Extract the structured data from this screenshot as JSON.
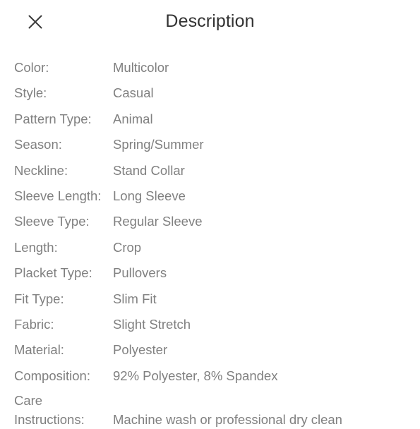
{
  "header": {
    "title": "Description",
    "close_icon": "close-icon"
  },
  "colors": {
    "background": "#ffffff",
    "title_text": "#333333",
    "body_text": "#808080",
    "icon": "#3c3c3c"
  },
  "attributes": [
    {
      "label": "Color:",
      "value": "Multicolor"
    },
    {
      "label": "Style:",
      "value": "Casual"
    },
    {
      "label": "Pattern Type:",
      "value": "Animal"
    },
    {
      "label": "Season:",
      "value": "Spring/Summer"
    },
    {
      "label": "Neckline:",
      "value": "Stand Collar"
    },
    {
      "label": "Sleeve Length:",
      "value": "Long Sleeve"
    },
    {
      "label": "Sleeve Type:",
      "value": "Regular Sleeve"
    },
    {
      "label": "Length:",
      "value": "Crop"
    },
    {
      "label": "Placket Type:",
      "value": "Pullovers"
    },
    {
      "label": "Fit Type:",
      "value": "Slim Fit"
    },
    {
      "label": "Fabric:",
      "value": "Slight Stretch"
    },
    {
      "label": "Material:",
      "value": "Polyester"
    },
    {
      "label": "Composition:",
      "value": "92% Polyester, 8% Spandex"
    },
    {
      "label": "Care Instructions:",
      "value": "Machine wash or professional dry clean"
    }
  ]
}
